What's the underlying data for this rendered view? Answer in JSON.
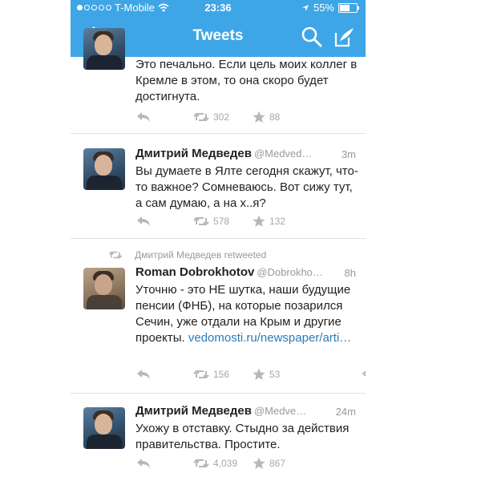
{
  "status_bar": {
    "carrier": "T-Mobile",
    "time": "23:36",
    "battery": "55%"
  },
  "nav": {
    "title": "Tweets",
    "icons": [
      "back-chevron-icon",
      "search-icon",
      "compose-icon"
    ]
  },
  "tweets": [
    {
      "text": "Это печально. Если цель моих коллег в Кремле в этом, то она скоро будет достигнута.",
      "retweets": "302",
      "favorites": "88"
    },
    {
      "author": "Дмитрий Медведев",
      "handle": "@Medved…",
      "time": "3m",
      "text": "Вы думаете в Ялте сегодня скажут, что-то важное? Сомневаюсь. Вот сижу тут, а сам думаю, а на х..я?",
      "retweets": "578",
      "favorites": "132"
    },
    {
      "retweeted_by": "Дмитрий Медведев retweeted",
      "author": "Roman Dobrokhotov",
      "handle": "@Dobrokho…",
      "time": "8h",
      "text": "Уточню - это НЕ шутка, наши будущие пенсии (ФНБ), на которые позарился Сечин, уже отдали на Крым и другие проекты.",
      "link": "vedomosti.ru/newspaper/arti…",
      "retweets": "156",
      "favorites": "53"
    },
    {
      "author": "Дмитрий Медведев",
      "handle": "@Medve…",
      "time": "24m",
      "text": "Ухожу в отставку. Стыдно за действия правительства. Простите.",
      "retweets": "4,039",
      "favorites": "867"
    }
  ],
  "colors": {
    "nav_bar": "#3ea6e7",
    "link": "#2b7bb9",
    "muted": "#9a9a9a"
  }
}
